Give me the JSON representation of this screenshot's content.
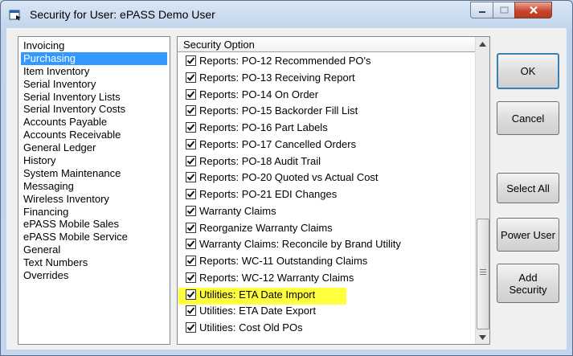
{
  "window": {
    "title": "Security for User: ePASS Demo User"
  },
  "categories": {
    "selected_index": 1,
    "items": [
      "Invoicing",
      "Purchasing",
      "Item Inventory",
      "Serial Inventory",
      "Serial Inventory Lists",
      "Serial Inventory Costs",
      "Accounts Payable",
      "Accounts Receivable",
      "General Ledger",
      "History",
      "System Maintenance",
      "Messaging",
      "Wireless Inventory",
      "Financing",
      "ePASS Mobile Sales",
      "ePASS Mobile Service",
      "General",
      "Text Numbers",
      "Overrides"
    ]
  },
  "options": {
    "header": "Security Option",
    "highlight_color": "#ffff3e",
    "rows": [
      {
        "label": "Reports: PO-12 Recommended PO's",
        "checked": true
      },
      {
        "label": "Reports: PO-13 Receiving Report",
        "checked": true
      },
      {
        "label": "Reports: PO-14 On Order",
        "checked": true
      },
      {
        "label": "Reports: PO-15 Backorder Fill List",
        "checked": true
      },
      {
        "label": "Reports: PO-16 Part Labels",
        "checked": true
      },
      {
        "label": "Reports: PO-17 Cancelled Orders",
        "checked": true
      },
      {
        "label": "Reports: PO-18 Audit Trail",
        "checked": true
      },
      {
        "label": "Reports: PO-20 Quoted vs Actual Cost",
        "checked": true
      },
      {
        "label": "Reports: PO-21 EDI Changes",
        "checked": true
      },
      {
        "label": "Warranty Claims",
        "checked": true
      },
      {
        "label": "Reorganize Warranty Claims",
        "checked": true
      },
      {
        "label": "Warranty Claims: Reconcile by Brand Utility",
        "checked": true
      },
      {
        "label": "Reports: WC-11 Outstanding Claims",
        "checked": true
      },
      {
        "label": "Reports: WC-12 Warranty Claims",
        "checked": true
      },
      {
        "label": "Utilities: ETA Date Import",
        "checked": true,
        "highlighted": true
      },
      {
        "label": "Utilities: ETA Date Export",
        "checked": true
      },
      {
        "label": "Utilities: Cost Old POs",
        "checked": true
      }
    ]
  },
  "buttons": {
    "ok": "OK",
    "cancel": "Cancel",
    "select_all": "Select All",
    "power_user": "Power User",
    "add_security_line1": "Add",
    "add_security_line2": "Security"
  },
  "icons": {
    "app": "app-window-icon",
    "minimize": "minimize-icon",
    "maximize": "maximize-icon",
    "close": "close-icon",
    "check": "check-icon",
    "scroll_up": "scroll-up-arrow-icon",
    "scroll_down": "scroll-down-arrow-icon"
  }
}
